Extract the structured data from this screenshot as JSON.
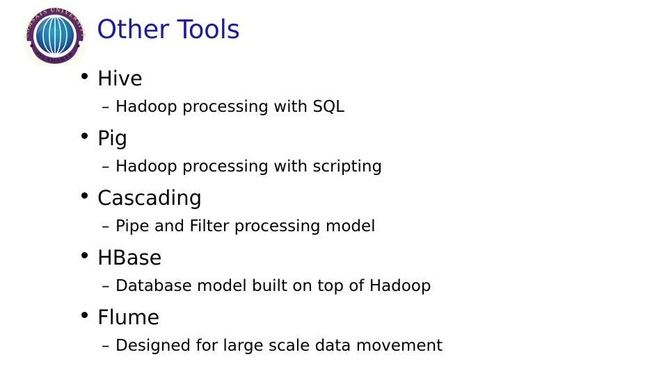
{
  "slide": {
    "title": "Other Tools",
    "title_color": "#1a1aab",
    "background_color": "#ffffff",
    "body_text_color": "#000000",
    "sub_bullet_marker": "–"
  },
  "logo": {
    "name": "comsats-university-islamabad-seal",
    "top_arc_text": "COMSATS UNIVERSITY",
    "bottom_arc_text": "ISLAMABAD",
    "ring_color": "#5c2a68",
    "band_color": "#fdfaf2",
    "arc_text_color": "#d9c27a",
    "bottom_text_color": "#2b1630",
    "globe_color_outer": "#1d2f86",
    "globe_color_inner": "#1f8fb5"
  },
  "content": {
    "items": [
      {
        "title": "Hive",
        "detail": "Hadoop processing with SQL"
      },
      {
        "title": "Pig",
        "detail": "Hadoop processing with scripting"
      },
      {
        "title": "Cascading",
        "detail": "Pipe and Filter processing model"
      },
      {
        "title": "HBase",
        "detail": "Database model built on top of Hadoop"
      },
      {
        "title": "Flume",
        "detail": "Designed for large scale data movement"
      }
    ]
  }
}
